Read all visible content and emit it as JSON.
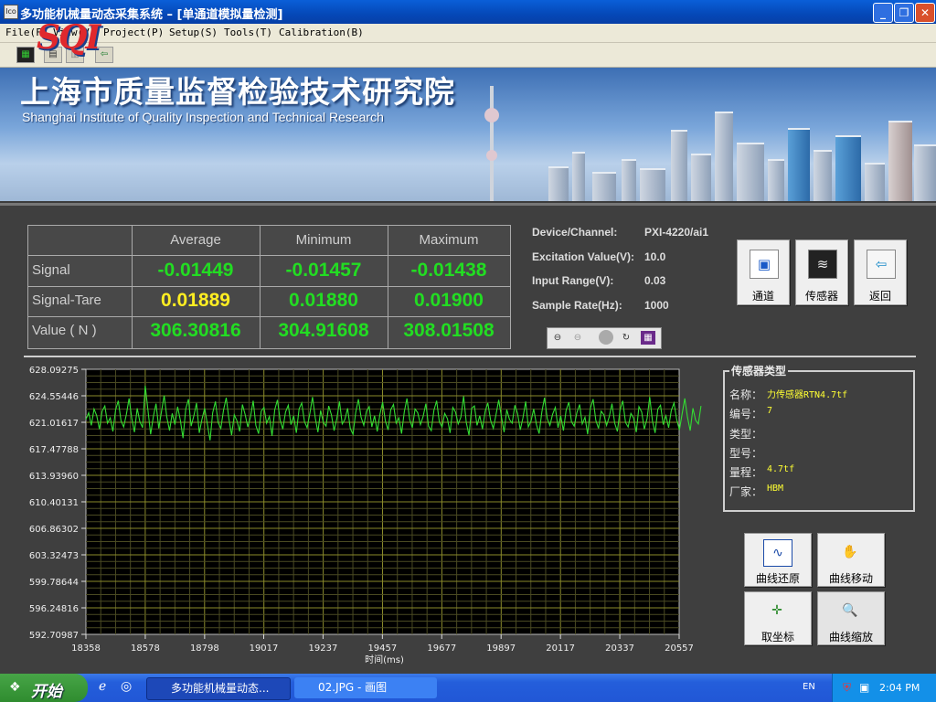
{
  "window": {
    "title": "多功能机械量动态采集系统 – [单通道模拟量检测]",
    "icon_text": "Ico"
  },
  "menu": [
    {
      "label": "File(F)"
    },
    {
      "label": "View(V)"
    },
    {
      "label": "Project(P)"
    },
    {
      "label": "Setup(S)"
    },
    {
      "label": "Tools(T)"
    },
    {
      "label": "Calibration(B)"
    }
  ],
  "banner": {
    "logo": "SQI",
    "org_cn": "上海市质量监督检验技术研究院",
    "org_en": "Shanghai  Institute of Quality Inspection and Technical Research"
  },
  "table": {
    "columns": [
      "Average",
      "Minimum",
      "Maximum"
    ],
    "rows": [
      {
        "label": "Signal",
        "values": [
          "-0.01449",
          "-0.01457",
          "-0.01438"
        ],
        "color": "#22dd22"
      },
      {
        "label": "Signal-Tare",
        "values": [
          "0.01889",
          "0.01880",
          "0.01900"
        ],
        "color": "#22dd22",
        "first_color": "#ffee22"
      },
      {
        "label": "Value ( N )",
        "values": [
          "306.30816",
          "304.91608",
          "308.01508"
        ],
        "color": "#22dd22"
      }
    ]
  },
  "device": {
    "channel_label": "Device/Channel:",
    "channel_value": "PXI-4220/ai1",
    "excitation_label": "Excitation Value(V):",
    "excitation_value": "10.0",
    "range_label": "Input Range(V):",
    "range_value": "0.03",
    "rate_label": "Sample Rate(Hz):",
    "rate_value": "1000"
  },
  "buttons": {
    "channel": "通道",
    "sensor": "传感器",
    "back": "返回"
  },
  "sensor": {
    "group_title": "传感器类型",
    "name_label": "名称：",
    "name_value": "力传感器RTN4.7tf",
    "number_label": "编号：",
    "number_value": "7",
    "class_label": "类型：",
    "class_value": "",
    "model_label": "型号：",
    "model_value": "",
    "range_label": "量程：",
    "range_value": "4.7tf",
    "maker_label": "厂家：",
    "maker_value": "HBM"
  },
  "curve_buttons": {
    "restore": "曲线还原",
    "move": "曲线移动",
    "coord": "取坐标",
    "zoom": "曲线缩放"
  },
  "chart_data": {
    "type": "line",
    "xlabel": "时间(ms)",
    "xlim": [
      18358,
      20557
    ],
    "ylim": [
      592.70987,
      628.09275
    ],
    "x_ticks": [
      "18358",
      "18578",
      "18798",
      "19017",
      "19237",
      "19457",
      "19677",
      "19897",
      "20117",
      "20337",
      "20557"
    ],
    "y_ticks": [
      "628.09275",
      "624.55446",
      "621.01617",
      "617.47788",
      "613.93960",
      "610.40131",
      "606.86302",
      "603.32473",
      "599.78644",
      "596.24816",
      "592.70987"
    ],
    "grid": true,
    "series_color": "#33dd33",
    "series": [
      {
        "x_start": 18358,
        "x_step": 10,
        "values": [
          621.4,
          622.3,
          620.6,
          622.8,
          621.9,
          620.1,
          622.5,
          623.2,
          620.9,
          621.6,
          619.8,
          622.7,
          623.9,
          621.2,
          620.4,
          622.1,
          624.2,
          621.5,
          619.7,
          622.9,
          621.1,
          620.3,
          625.9,
          622.6,
          619.4,
          621.8,
          623.5,
          620.2,
          622.4,
          624.6,
          621.7,
          619.9,
          622.2,
          620.7,
          623.1,
          621.3,
          618.9,
          622.8,
          624.1,
          620.5,
          621.9,
          623.6,
          619.6,
          621.4,
          622.9,
          620.8,
          618.6,
          622.3,
          623.8,
          621.0,
          620.2,
          622.6,
          624.3,
          621.5,
          619.3,
          622.0,
          621.2,
          619.8,
          623.4,
          622.1,
          620.4,
          621.7,
          623.9,
          620.6,
          619.5,
          622.5,
          623.0,
          620.9,
          621.8,
          619.2,
          622.7,
          624.0,
          621.3,
          620.1,
          622.4,
          623.3,
          620.7,
          621.9,
          619.6,
          622.8,
          623.6,
          621.1,
          620.3,
          622.2,
          624.4,
          621.6,
          619.7,
          622.6,
          621.0,
          620.5,
          623.2,
          622.0,
          619.9,
          621.5,
          623.8,
          620.8,
          621.4,
          622.9,
          620.2,
          619.4,
          622.3,
          624.1,
          621.7,
          620.6,
          622.5,
          623.1,
          620.4,
          621.9,
          619.8,
          622.1,
          623.7,
          621.2,
          620.0,
          622.7,
          623.4,
          620.9,
          621.6,
          619.5,
          622.4,
          624.2,
          621.4,
          620.3,
          622.8,
          622.3,
          620.7,
          621.8,
          623.5,
          620.5,
          619.9,
          622.6,
          623.9,
          621.1,
          620.4,
          622.2,
          621.5,
          619.6,
          623.0,
          622.4,
          620.8,
          621.7,
          624.5,
          621.0,
          619.3,
          622.9,
          623.2,
          620.6,
          621.9,
          620.1,
          622.5,
          623.6,
          621.3,
          620.2,
          622.0,
          624.0,
          621.8,
          619.7,
          622.7,
          621.4,
          620.9,
          623.3,
          622.2,
          620.0,
          621.6,
          623.8,
          620.4,
          621.2,
          622.8,
          620.7,
          619.5,
          622.4,
          624.3,
          621.5,
          620.6,
          622.1,
          623.0,
          620.3,
          621.9,
          619.9,
          622.6,
          623.7,
          621.1,
          620.5,
          622.3,
          623.4,
          620.8,
          621.7,
          619.4,
          622.9,
          624.1,
          621.3,
          620.2,
          622.5,
          622.0,
          620.6,
          621.8,
          623.5,
          620.9,
          619.8,
          622.7,
          623.9,
          621.0,
          620.4,
          622.2,
          621.6,
          619.7,
          623.1,
          622.4,
          620.1,
          621.5,
          624.4,
          621.2,
          619.6,
          622.8,
          623.3,
          620.7,
          621.9,
          620.3,
          622.6,
          623.6,
          621.4,
          620.0,
          622.1,
          624.2,
          621.7,
          619.9,
          622.9,
          621.3,
          620.8,
          623.2
        ]
      }
    ]
  },
  "taskbar": {
    "start": "开始",
    "task1": "多功能机械量动态...",
    "task2": "02.JPG - 画图",
    "lang": "EN",
    "clock": "2:04 PM"
  }
}
